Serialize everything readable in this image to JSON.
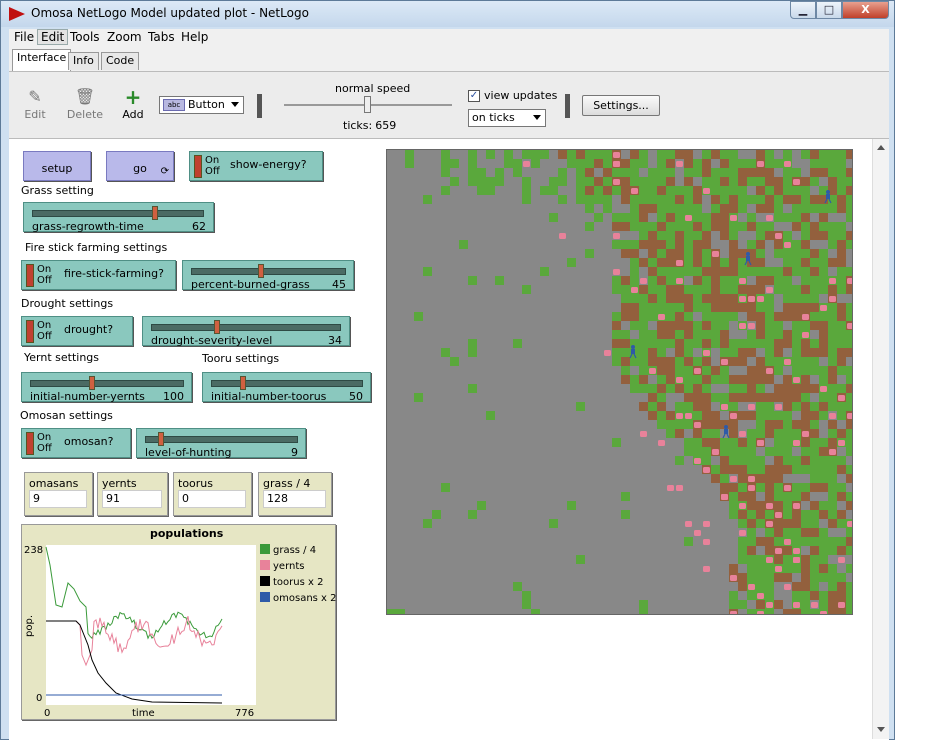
{
  "window": {
    "title": "Omosa NetLogo Model updated plot - NetLogo"
  },
  "window_buttons": {
    "minimize": "▁",
    "maximize": "□",
    "close": "X"
  },
  "menu": [
    "File",
    "Edit",
    "Tools",
    "Zoom",
    "Tabs",
    "Help"
  ],
  "tabs": [
    "Interface",
    "Info",
    "Code"
  ],
  "toolbar": {
    "edit": "Edit",
    "delete": "Delete",
    "add": "Add",
    "widget_type": "Button",
    "abc_icon": "abc",
    "speed_label": "normal speed",
    "ticks_label": "ticks:",
    "ticks_value": "659",
    "view_updates_label": "view updates",
    "view_updates_checked": "✓",
    "update_mode": "on ticks",
    "settings": "Settings..."
  },
  "widgets": {
    "setup": "setup",
    "go": "go",
    "forever_icon": "⟳",
    "switch_on": "On",
    "switch_off": "Off",
    "show_energy": "show-energy?",
    "grass_setting": "Grass setting",
    "grass_regrowth": {
      "name": "grass-regrowth-time",
      "value": "62",
      "fraction": 0.72
    },
    "fire_settings": "Fire stick farming settings",
    "fire_stick": "fire-stick-farming?",
    "percent_burned": {
      "name": "percent-burned-grass",
      "value": "45",
      "fraction": 0.45
    },
    "drought_settings": "Drought settings",
    "drought": "drought?",
    "drought_severity": {
      "name": "drought-severity-level",
      "value": "34",
      "fraction": 0.34
    },
    "yernt_settings": "Yernt settings",
    "tooru_settings": "Tooru settings",
    "initial_yernts": {
      "name": "initial-number-yernts",
      "value": "100",
      "fraction": 0.4
    },
    "initial_toorus": {
      "name": "initial-number-toorus",
      "value": "50",
      "fraction": 0.2
    },
    "omosan_settings": "Omosan settings",
    "omosan": "omosan?",
    "hunting": {
      "name": "level-of-hunting",
      "value": "9",
      "fraction": 0.09
    }
  },
  "monitors": [
    {
      "name": "omasans",
      "value": "9"
    },
    {
      "name": "yernts",
      "value": "91"
    },
    {
      "name": "toorus",
      "value": "0"
    },
    {
      "name": "grass / 4",
      "value": "128"
    }
  ],
  "plot": {
    "title": "populations",
    "ylabel": "pop.",
    "xlabel": "time",
    "xmin": "0",
    "xmax": "776",
    "ymin": "0",
    "ymax": "238",
    "legend": [
      {
        "name": "grass / 4",
        "color": "#3a9a3a"
      },
      {
        "name": "yernts",
        "color": "#e8829a"
      },
      {
        "name": "toorus x 2",
        "color": "#000000"
      },
      {
        "name": "omosans x 2",
        "color": "#2e5aa8"
      }
    ]
  },
  "colors": {
    "grass": "#5aa83c",
    "dirt": "#93603d",
    "empty": "#8a8a8a",
    "yernt": "#e8829a",
    "omosan": "#2e5aa8"
  }
}
